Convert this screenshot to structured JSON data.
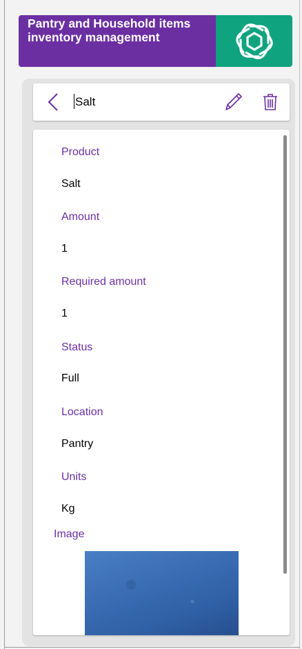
{
  "header": {
    "title": "Pantry and Household items inventory management",
    "logo_icon": "openai-knot-icon",
    "title_bg": "#6b2fa2",
    "logo_bg": "#10a37f"
  },
  "detail": {
    "title": "Salt",
    "back_icon": "chevron-left-icon",
    "edit_icon": "pencil-icon",
    "delete_icon": "trash-icon"
  },
  "fields": [
    {
      "label": "Product",
      "value": "Salt"
    },
    {
      "label": "Amount",
      "value": "1"
    },
    {
      "label": "Required amount",
      "value": "1"
    },
    {
      "label": "Status",
      "value": "Full"
    },
    {
      "label": "Location",
      "value": "Pantry"
    },
    {
      "label": "Units",
      "value": "Kg"
    }
  ],
  "image": {
    "label": "Image"
  },
  "colors": {
    "accent": "#6b2fa2",
    "brand_green": "#10a37f"
  }
}
